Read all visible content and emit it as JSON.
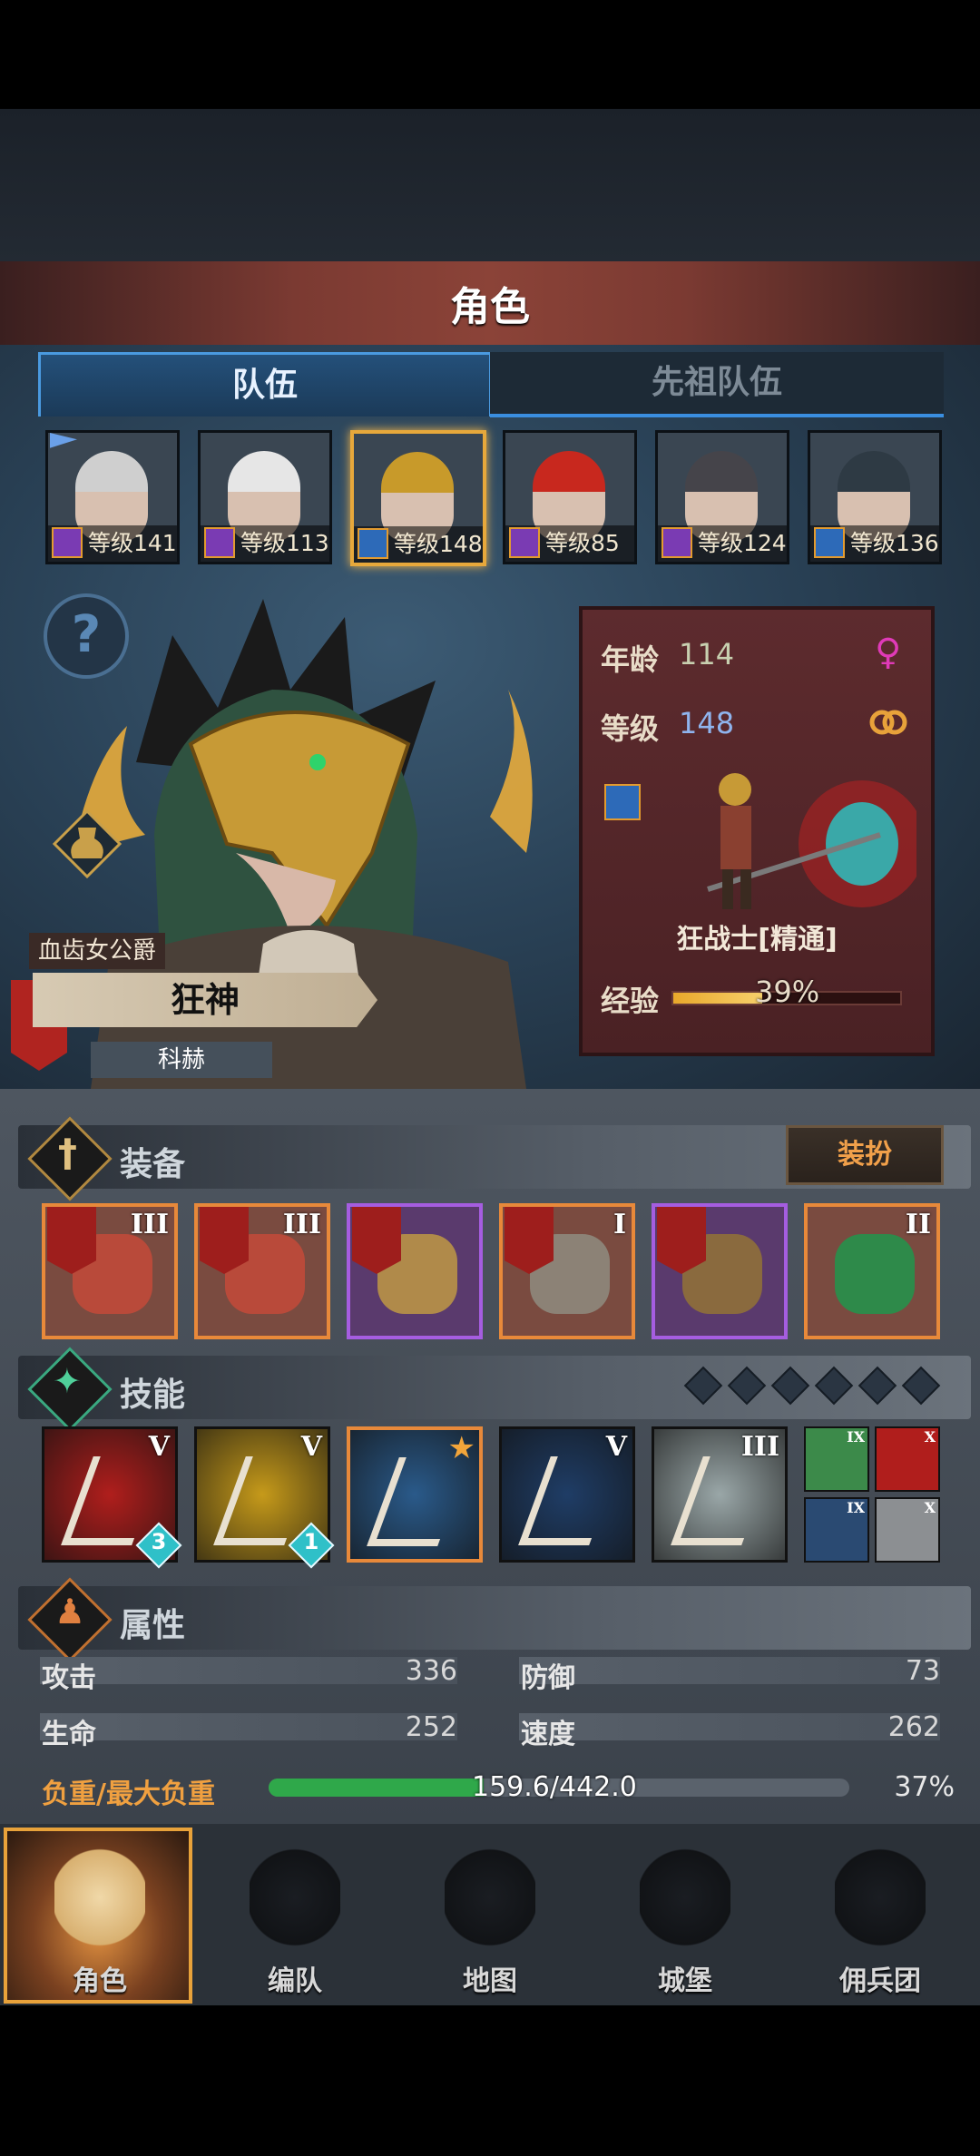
{
  "header": {
    "title": "角色"
  },
  "tabs": [
    {
      "label": "队伍",
      "active": true
    },
    {
      "label": "先祖队伍",
      "active": false
    }
  ],
  "roster": [
    {
      "level_text": "等级141",
      "hair": "#cfcfcf",
      "class_icon": "staff-icon",
      "class_color": "#7a3bb3",
      "flag": true
    },
    {
      "level_text": "等级113",
      "hair": "#e6e6e6",
      "class_icon": "staff-icon",
      "class_color": "#7a3bb3",
      "flag": false
    },
    {
      "level_text": "等级148",
      "hair": "#c89a2a",
      "class_icon": "sword-icon",
      "class_color": "#2d6ab8",
      "selected": true
    },
    {
      "level_text": "等级85",
      "hair": "#c8281e",
      "class_icon": "staff-icon",
      "class_color": "#7a3bb3"
    },
    {
      "level_text": "等级124",
      "hair": "#45444a",
      "class_icon": "staff-icon",
      "class_color": "#7a3bb3"
    },
    {
      "level_text": "等级136",
      "hair": "#2e3a44",
      "class_icon": "sword-icon",
      "class_color": "#2d6ab8"
    }
  ],
  "character": {
    "nobility": "血齿女公爵",
    "title": "狂神",
    "name": "科赫",
    "age_label": "年龄",
    "age": "114",
    "level_label": "等级",
    "level": "148",
    "class_name": "狂战士[精通]",
    "xp_label": "经验",
    "xp_percent_text": "39%",
    "xp_fraction": 0.39
  },
  "equipment": {
    "label": "装备",
    "outfit_button": "装扮",
    "slots": [
      {
        "item": "axe",
        "rank": "III",
        "rarity": "orange"
      },
      {
        "item": "axe",
        "rank": "III",
        "rarity": "orange"
      },
      {
        "item": "helmet",
        "rank": "",
        "rarity": "purple"
      },
      {
        "item": "armor",
        "rank": "I",
        "rarity": "orange"
      },
      {
        "item": "boots",
        "rank": "",
        "rarity": "purple"
      },
      {
        "item": "ring",
        "rank": "II",
        "rarity": "orange"
      }
    ]
  },
  "skills": {
    "label": "技能",
    "big": [
      {
        "bg": "#b01e1c",
        "rank": "V",
        "badge": "3"
      },
      {
        "bg": "#c69a1a",
        "rank": "V",
        "badge": "1"
      },
      {
        "bg": "#2a5a8a",
        "rank": "",
        "star": true
      },
      {
        "bg": "#1f3d66",
        "rank": "V"
      },
      {
        "bg": "#9aa7a8",
        "rank": "III"
      }
    ],
    "small": [
      {
        "bg": "#3c8a4a",
        "rank": "IX"
      },
      {
        "bg": "#b01e1c",
        "rank": "X"
      },
      {
        "bg": "#2a4a72",
        "rank": "IX"
      },
      {
        "bg": "#8c8f92",
        "rank": "X"
      }
    ]
  },
  "attributes": {
    "label": "属性",
    "attack_label": "攻击",
    "attack": "336",
    "defense_label": "防御",
    "defense": "73",
    "hp_label": "生命",
    "hp": "252",
    "speed_label": "速度",
    "speed": "262",
    "load_label": "负重/最大负重",
    "load_text": "159.6/442.0",
    "load_percent_text": "37%",
    "load_fraction": 0.37
  },
  "nav": [
    {
      "label": "角色",
      "icon": "knight-icon",
      "active": true
    },
    {
      "label": "编队",
      "icon": "helmet-icon"
    },
    {
      "label": "地图",
      "icon": "compass-icon"
    },
    {
      "label": "城堡",
      "icon": "castle-icon"
    },
    {
      "label": "佣兵团",
      "icon": "mercenary-icon"
    }
  ],
  "colors": {
    "accent": "#e8a23a",
    "xp": "#e8a82b",
    "load": "#2fa84a"
  }
}
